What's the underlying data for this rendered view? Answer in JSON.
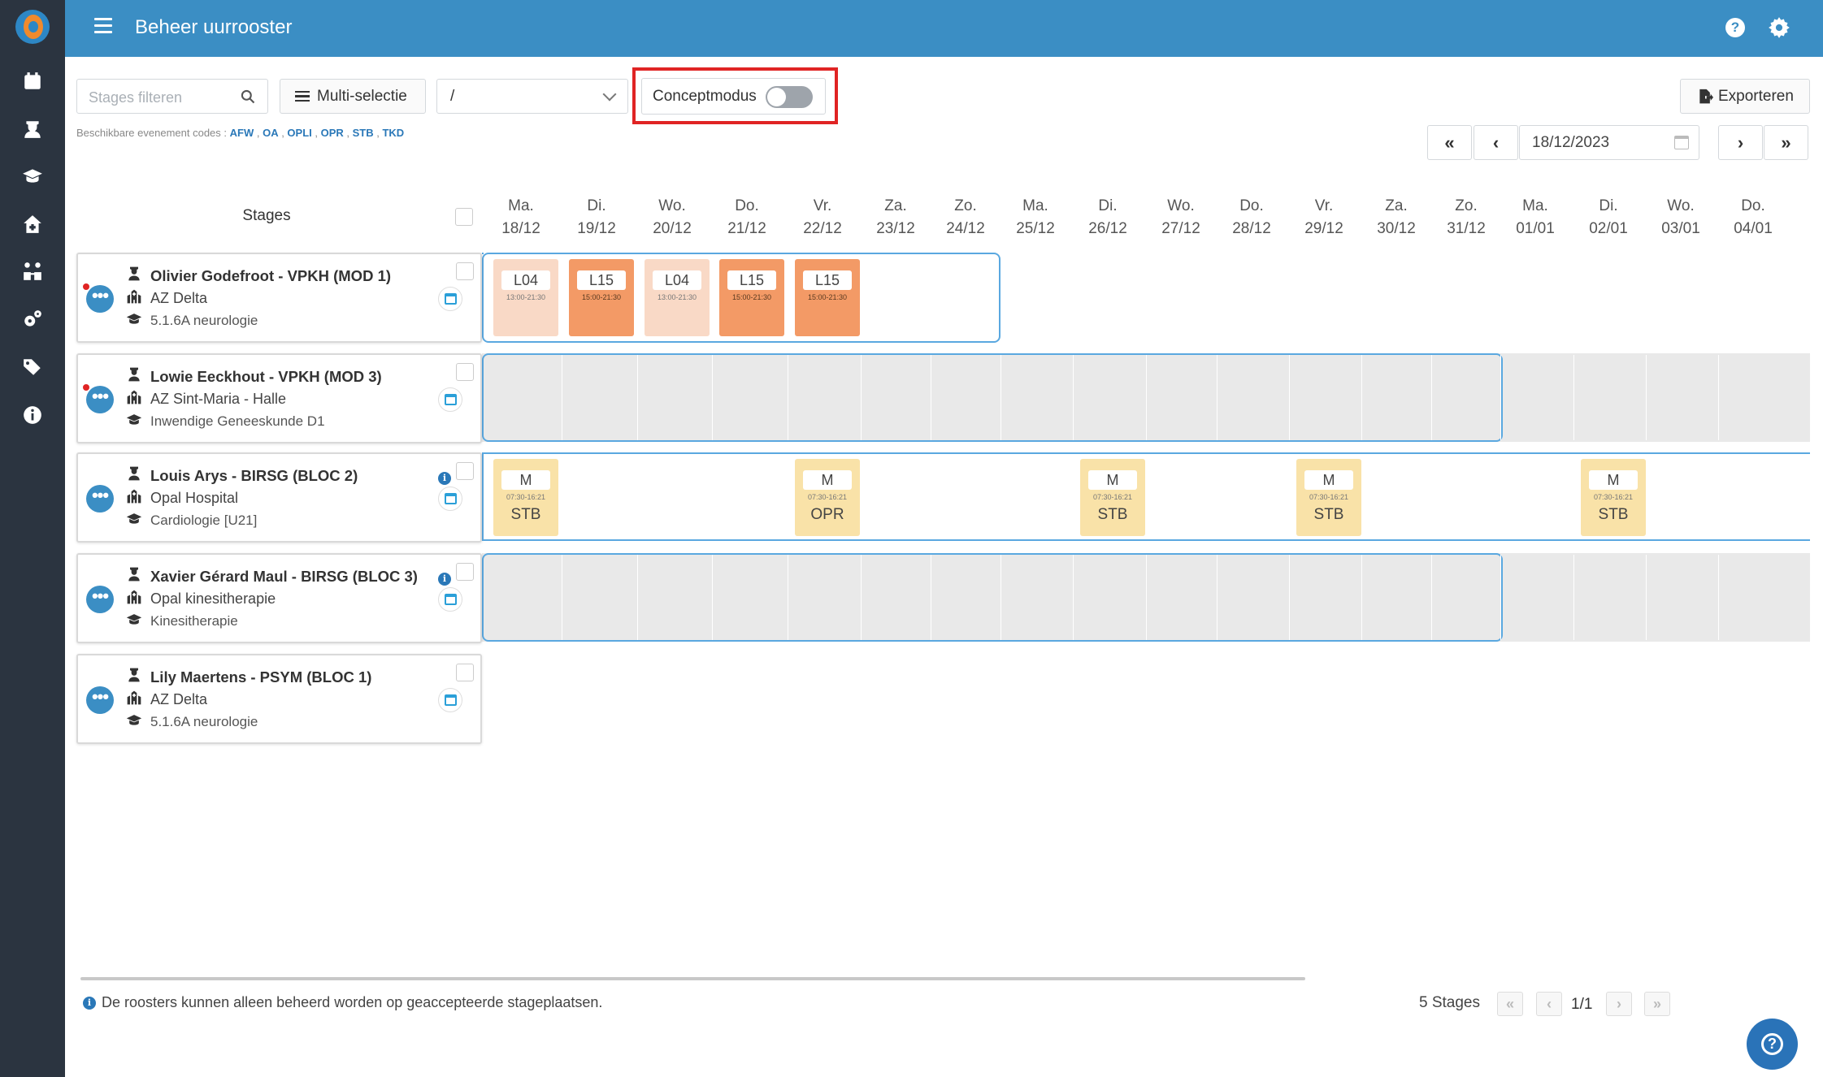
{
  "app": {
    "title": "Beheer uurrooster"
  },
  "toolbar": {
    "search_placeholder": "Stages filteren",
    "multi_select_label": "Multi-selectie",
    "select_value": "/",
    "concept_label": "Conceptmodus",
    "concept_enabled": false,
    "export_label": "Exporteren",
    "codes_prefix": "Beschikbare evenement codes :",
    "codes": [
      "AFW",
      "OA",
      "OPLI",
      "OPR",
      "STB",
      "TKD"
    ]
  },
  "datenav": {
    "first": "«",
    "prev": "‹",
    "date": "18/12/2023",
    "next": "›",
    "last": "»"
  },
  "grid": {
    "stages_header": "Stages",
    "days": [
      {
        "dow": "Ma.",
        "date": "18/12"
      },
      {
        "dow": "Di.",
        "date": "19/12"
      },
      {
        "dow": "Wo.",
        "date": "20/12"
      },
      {
        "dow": "Do.",
        "date": "21/12"
      },
      {
        "dow": "Vr.",
        "date": "22/12"
      },
      {
        "dow": "Za.",
        "date": "23/12"
      },
      {
        "dow": "Zo.",
        "date": "24/12"
      },
      {
        "dow": "Ma.",
        "date": "25/12"
      },
      {
        "dow": "Di.",
        "date": "26/12"
      },
      {
        "dow": "Wo.",
        "date": "27/12"
      },
      {
        "dow": "Do.",
        "date": "28/12"
      },
      {
        "dow": "Vr.",
        "date": "29/12"
      },
      {
        "dow": "Za.",
        "date": "30/12"
      },
      {
        "dow": "Zo.",
        "date": "31/12"
      },
      {
        "dow": "Ma.",
        "date": "01/01"
      },
      {
        "dow": "Di.",
        "date": "02/01"
      },
      {
        "dow": "Wo.",
        "date": "03/01"
      },
      {
        "dow": "Do.",
        "date": "04/01"
      }
    ]
  },
  "rows": [
    {
      "name": "Olivier Godefroot - VPKH (MOD 1)",
      "location": "AZ Delta",
      "unit": "5.1.6A neurologie",
      "events": [
        {
          "code": "L04",
          "time": "13:00-21:30",
          "day": 0
        },
        {
          "code": "L15",
          "time": "15:00-21:30",
          "day": 1
        },
        {
          "code": "L04",
          "time": "13:00-21:30",
          "day": 2
        },
        {
          "code": "L15",
          "time": "15:00-21:30",
          "day": 3
        },
        {
          "code": "L15",
          "time": "15:00-21:30",
          "day": 4
        }
      ]
    },
    {
      "name": "Lowie Eeckhout - VPKH (MOD 3)",
      "location": "AZ Sint-Maria - Halle",
      "unit": "Inwendige Geneeskunde D1",
      "events": []
    },
    {
      "name": "Louis Arys - BIRSG (BLOC 2)",
      "location": "Opal Hospital",
      "unit": "Cardiologie [U21]",
      "events": [
        {
          "code": "M",
          "time": "07:30-16:21",
          "tag": "STB",
          "day": 0
        },
        {
          "code": "M",
          "time": "07:30-16:21",
          "tag": "OPR",
          "day": 4
        },
        {
          "code": "M",
          "time": "07:30-16:21",
          "tag": "STB",
          "day": 8
        },
        {
          "code": "M",
          "time": "07:30-16:21",
          "tag": "STB",
          "day": 11
        },
        {
          "code": "M",
          "time": "07:30-16:21",
          "tag": "STB",
          "day": 15
        }
      ]
    },
    {
      "name": "Xavier Gérard Maul - BIRSG (BLOC 3)",
      "location": "Opal kinesitherapie",
      "unit": "Kinesitherapie",
      "events": []
    },
    {
      "name": "Lily Maertens - PSYM (BLOC 1)",
      "location": "AZ Delta",
      "unit": "5.1.6A neurologie",
      "events": []
    }
  ],
  "footer": {
    "note": "De roosters kunnen alleen beheerd worden op geaccepteerde stageplaatsen.",
    "count": "5 Stages",
    "page": "1/1"
  },
  "colors": {
    "sidebar": "#2b3440",
    "topbar": "#3b8ec4",
    "event_light": "#f9d9c6",
    "event_dark": "#f39a66",
    "event_yellow": "#f9e2a8",
    "frame": "#5aa8e0",
    "highlight": "#e02424"
  }
}
